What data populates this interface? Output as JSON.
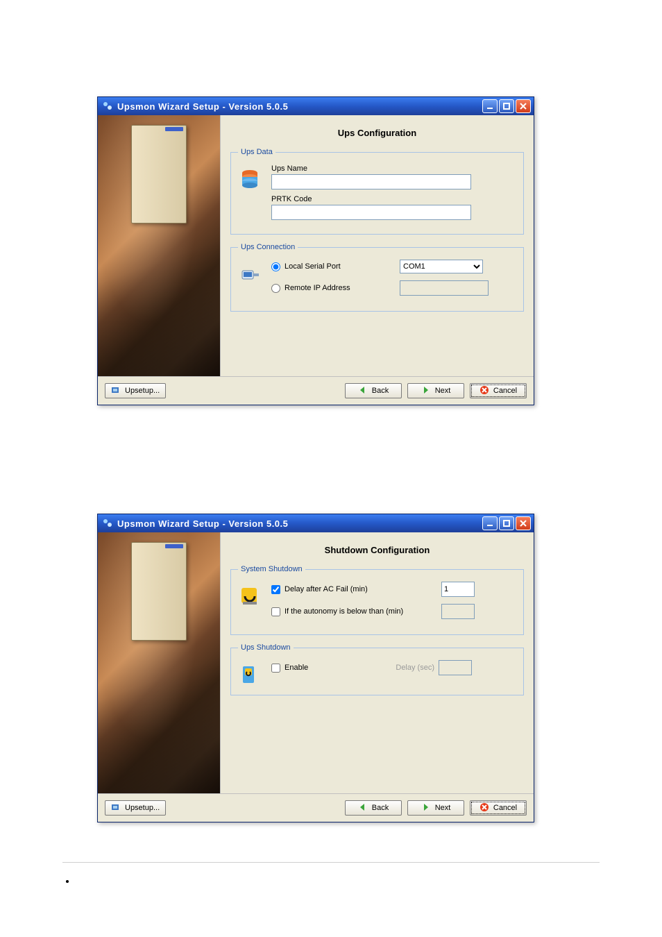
{
  "windows": [
    {
      "title": "Upsmon Wizard Setup - Version 5.0.5",
      "page_title": "Ups Configuration",
      "groups": {
        "ups_data": {
          "legend": "Ups Data",
          "fields": {
            "name_label": "Ups Name",
            "name_value": "",
            "prtk_label": "PRTK Code",
            "prtk_value": ""
          }
        },
        "ups_connection": {
          "legend": "Ups Connection",
          "local_label": "Local Serial Port",
          "local_selected": true,
          "port_options": [
            "COM1"
          ],
          "port_value": "COM1",
          "remote_label": "Remote IP Address",
          "remote_selected": false,
          "remote_value": ""
        }
      },
      "footer": {
        "upsetup": "Upsetup...",
        "back": "Back",
        "next": "Next",
        "cancel": "Cancel"
      }
    },
    {
      "title": "Upsmon Wizard Setup - Version 5.0.5",
      "page_title": "Shutdown Configuration",
      "groups": {
        "system_shutdown": {
          "legend": "System Shutdown",
          "delay_checked": true,
          "delay_label": "Delay after AC Fail (min)",
          "delay_value": "1",
          "autonomy_checked": false,
          "autonomy_label": "If the autonomy is below than (min)",
          "autonomy_value": ""
        },
        "ups_shutdown": {
          "legend": "Ups Shutdown",
          "enable_checked": false,
          "enable_label": "Enable",
          "delay_label": "Delay (sec)",
          "delay_value": ""
        }
      },
      "footer": {
        "upsetup": "Upsetup...",
        "back": "Back",
        "next": "Next",
        "cancel": "Cancel"
      }
    }
  ]
}
